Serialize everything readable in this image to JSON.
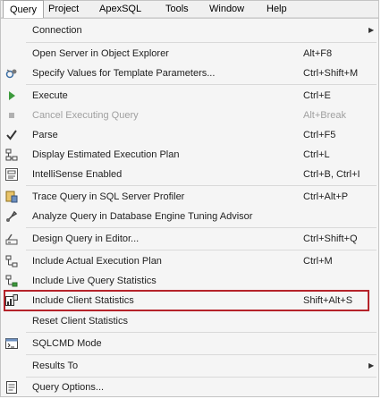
{
  "menubar": {
    "items": [
      "Query",
      "Project",
      "ApexSQL",
      "Tools",
      "Window",
      "Help"
    ],
    "active": "Query"
  },
  "menu": {
    "items": [
      {
        "label": "Connection",
        "shortcut": "",
        "submenu": true,
        "icon": "none"
      },
      {
        "label": "Open Server in Object Explorer",
        "shortcut": "Alt+F8",
        "icon": "none"
      },
      {
        "label": "Specify Values for Template Parameters...",
        "shortcut": "Ctrl+Shift+M",
        "icon": "template-parameters-icon"
      },
      {
        "label": "Execute",
        "shortcut": "Ctrl+E",
        "icon": "execute-play-icon"
      },
      {
        "label": "Cancel Executing Query",
        "shortcut": "Alt+Break",
        "disabled": true,
        "icon": "stop-icon"
      },
      {
        "label": "Parse",
        "shortcut": "Ctrl+F5",
        "icon": "checkmark-icon"
      },
      {
        "label": "Display Estimated Execution Plan",
        "shortcut": "Ctrl+L",
        "icon": "execution-plan-icon"
      },
      {
        "label": "IntelliSense Enabled",
        "shortcut": "Ctrl+B, Ctrl+I",
        "icon": "intellisense-icon"
      },
      {
        "label": "Trace Query in SQL Server Profiler",
        "shortcut": "Ctrl+Alt+P",
        "icon": "profiler-icon"
      },
      {
        "label": "Analyze Query in Database Engine Tuning Advisor",
        "shortcut": "",
        "icon": "tuning-advisor-icon"
      },
      {
        "label": "Design Query in Editor...",
        "shortcut": "Ctrl+Shift+Q",
        "icon": "design-query-icon"
      },
      {
        "label": "Include Actual Execution Plan",
        "shortcut": "Ctrl+M",
        "icon": "actual-plan-icon"
      },
      {
        "label": "Include Live Query Statistics",
        "shortcut": "",
        "icon": "live-stats-icon"
      },
      {
        "label": "Include Client Statistics",
        "shortcut": "Shift+Alt+S",
        "icon": "client-statistics-icon"
      },
      {
        "label": "Reset Client Statistics",
        "shortcut": "",
        "icon": "none"
      },
      {
        "label": "SQLCMD Mode",
        "shortcut": "",
        "icon": "sqlcmd-icon"
      },
      {
        "label": "Results To",
        "shortcut": "",
        "submenu": true,
        "icon": "none"
      },
      {
        "label": "Query Options...",
        "shortcut": "",
        "icon": "query-options-icon"
      }
    ]
  },
  "colors": {
    "highlight_border": "#b5232a",
    "execute_green": "#3c9a3c"
  }
}
